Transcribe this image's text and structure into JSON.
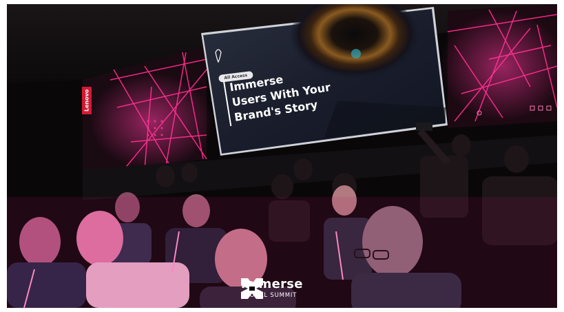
{
  "screen": {
    "badge": "All Access",
    "headline_lines": [
      "Immerse",
      "Users With Your",
      "Brand's Story"
    ],
    "side_logo": "Lenovo"
  },
  "brand": {
    "name": "immerse",
    "subtitle": "GLOBAL SUMMIT"
  },
  "colors": {
    "neon": "#ff2a8a",
    "magenta_light": "#c8106e",
    "background": "#0a0709",
    "white": "#ffffff",
    "side_logo": "#d21a35"
  }
}
